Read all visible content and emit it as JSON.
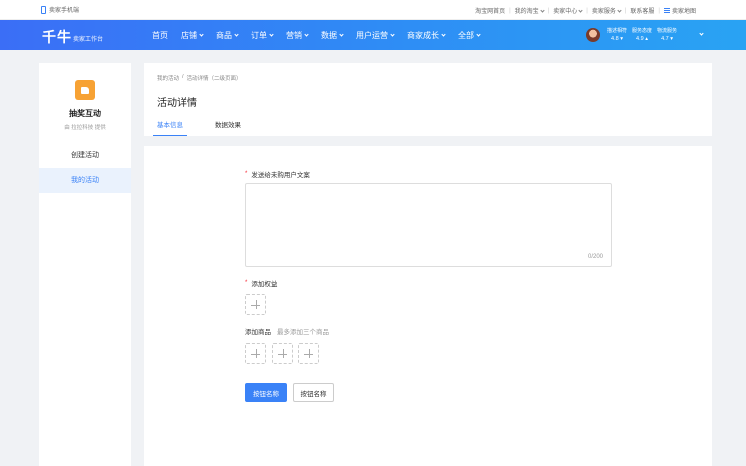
{
  "utilbar": {
    "mobile_label": "卖家手机端",
    "links": [
      {
        "label": "淘宝网首页",
        "dropdown": false
      },
      {
        "label": "我的淘宝",
        "dropdown": true
      },
      {
        "label": "卖家中心",
        "dropdown": true
      },
      {
        "label": "卖家服务",
        "dropdown": true
      },
      {
        "label": "联系客服",
        "dropdown": false
      }
    ],
    "sitemap_label": "卖家地图"
  },
  "nav": {
    "logo": "千牛",
    "logo_sub": "卖家工作台",
    "menu": [
      {
        "label": "首页",
        "dropdown": false
      },
      {
        "label": "店铺",
        "dropdown": true
      },
      {
        "label": "商品",
        "dropdown": true
      },
      {
        "label": "订单",
        "dropdown": true
      },
      {
        "label": "营销",
        "dropdown": true
      },
      {
        "label": "数据",
        "dropdown": true
      },
      {
        "label": "用户运营",
        "dropdown": true
      },
      {
        "label": "商家成长",
        "dropdown": true
      },
      {
        "label": "全部",
        "dropdown": true
      }
    ],
    "scores": [
      {
        "label": "描述相符",
        "value": "4.8 ▾"
      },
      {
        "label": "服务态度",
        "value": "4.9 ▴"
      },
      {
        "label": "物流服务",
        "value": "4.7 ▾"
      }
    ]
  },
  "sidebar": {
    "app_name": "抽奖互动",
    "app_by": "由 拉拉科技 提供",
    "items": [
      {
        "label": "创建活动",
        "active": false
      },
      {
        "label": "我的活动",
        "active": true
      }
    ]
  },
  "header": {
    "breadcrumb": [
      "我的活动",
      "/",
      "活动详情（二级页面）"
    ],
    "title": "活动详情",
    "tabs": [
      {
        "label": "基本信息",
        "active": true
      },
      {
        "label": "数据效果",
        "active": false
      }
    ]
  },
  "form": {
    "message_label": "发送给未购用户文案",
    "message_value": "",
    "message_count": "0/200",
    "benefit_label": "添加权益",
    "goods_label": "添加商品",
    "goods_hint": "最多添加三个商品",
    "primary_button": "按钮名称",
    "default_button": "按钮名称"
  },
  "colors": {
    "accent": "#3a82f7",
    "required": "#f5222d",
    "app_icon": "#f7a234"
  }
}
